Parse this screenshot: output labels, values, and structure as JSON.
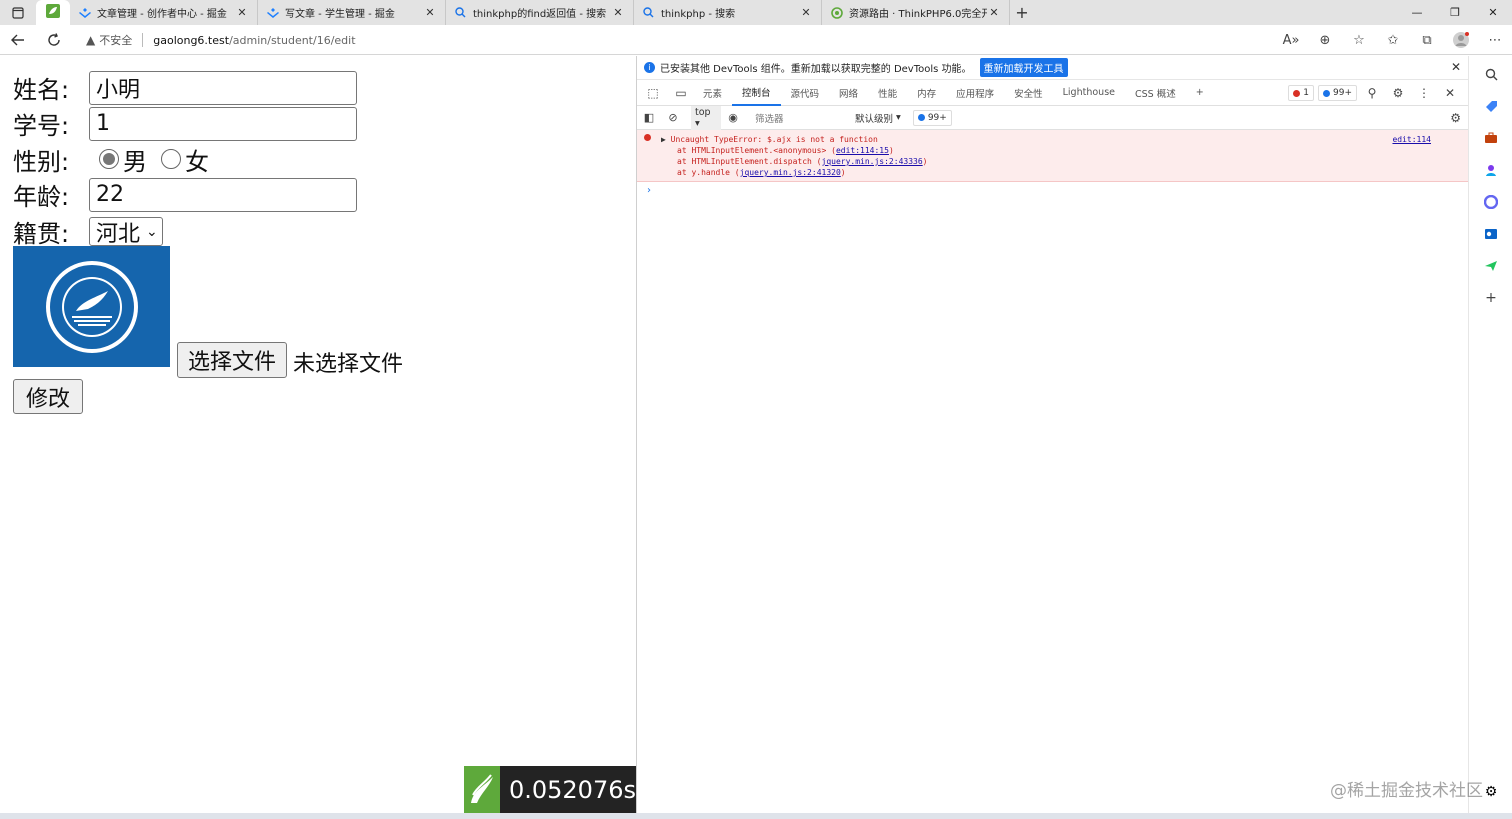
{
  "tabs": [
    {
      "title": "文章管理 - 创作者中心 - 掘金",
      "icon": "juejin-icon"
    },
    {
      "title": "写文章 - 学生管理 - 掘金",
      "icon": "juejin-icon"
    },
    {
      "title": "thinkphp的find返回值 - 搜索",
      "icon": "search-icon"
    },
    {
      "title": "thinkphp - 搜索",
      "icon": "search-icon"
    },
    {
      "title": "资源路由 · ThinkPHP6.0完全开发",
      "icon": "doc-icon"
    }
  ],
  "address": {
    "security_label": "不安全",
    "host": "gaolong6.test",
    "path": "/admin/student/16/edit"
  },
  "form": {
    "name_label": "姓名:",
    "name_value": "小明",
    "id_label": "学号:",
    "id_value": "1",
    "gender_label": "性别:",
    "gender_male": "男",
    "gender_female": "女",
    "age_label": "年龄:",
    "age_value": "22",
    "origin_label": "籍贯:",
    "origin_value": "河北",
    "file_button": "选择文件",
    "file_status": "未选择文件",
    "submit": "修改"
  },
  "trace": {
    "time": "0.052076s"
  },
  "devtools": {
    "banner_text": "已安装其他 DevTools 组件。重新加载以获取完整的 DevTools 功能。",
    "banner_button": "重新加载开发工具",
    "tabs": [
      "元素",
      "控制台",
      "源代码",
      "网络",
      "性能",
      "内存",
      "应用程序",
      "安全性",
      "Lighthouse",
      "CSS 概述"
    ],
    "error_count": "1",
    "message_count": "99+",
    "context": "top",
    "filter_placeholder": "筛选器",
    "levels": "默认级别",
    "console_badge": "99+",
    "error": {
      "line1": "Uncaught TypeError: $.ajx is not a function",
      "line2_prefix": "at HTMLInputElement.<anonymous> (",
      "line2_link": "edit:114:15",
      "line3_prefix": "at HTMLInputElement.dispatch (",
      "line3_link": "jquery.min.js:2:43336",
      "line4_prefix": "at y.handle (",
      "line4_link": "jquery.min.js:2:41320",
      "close_paren": ")",
      "source": "edit:114"
    },
    "prompt": "›"
  },
  "watermark": "@稀土掘金技术社区"
}
